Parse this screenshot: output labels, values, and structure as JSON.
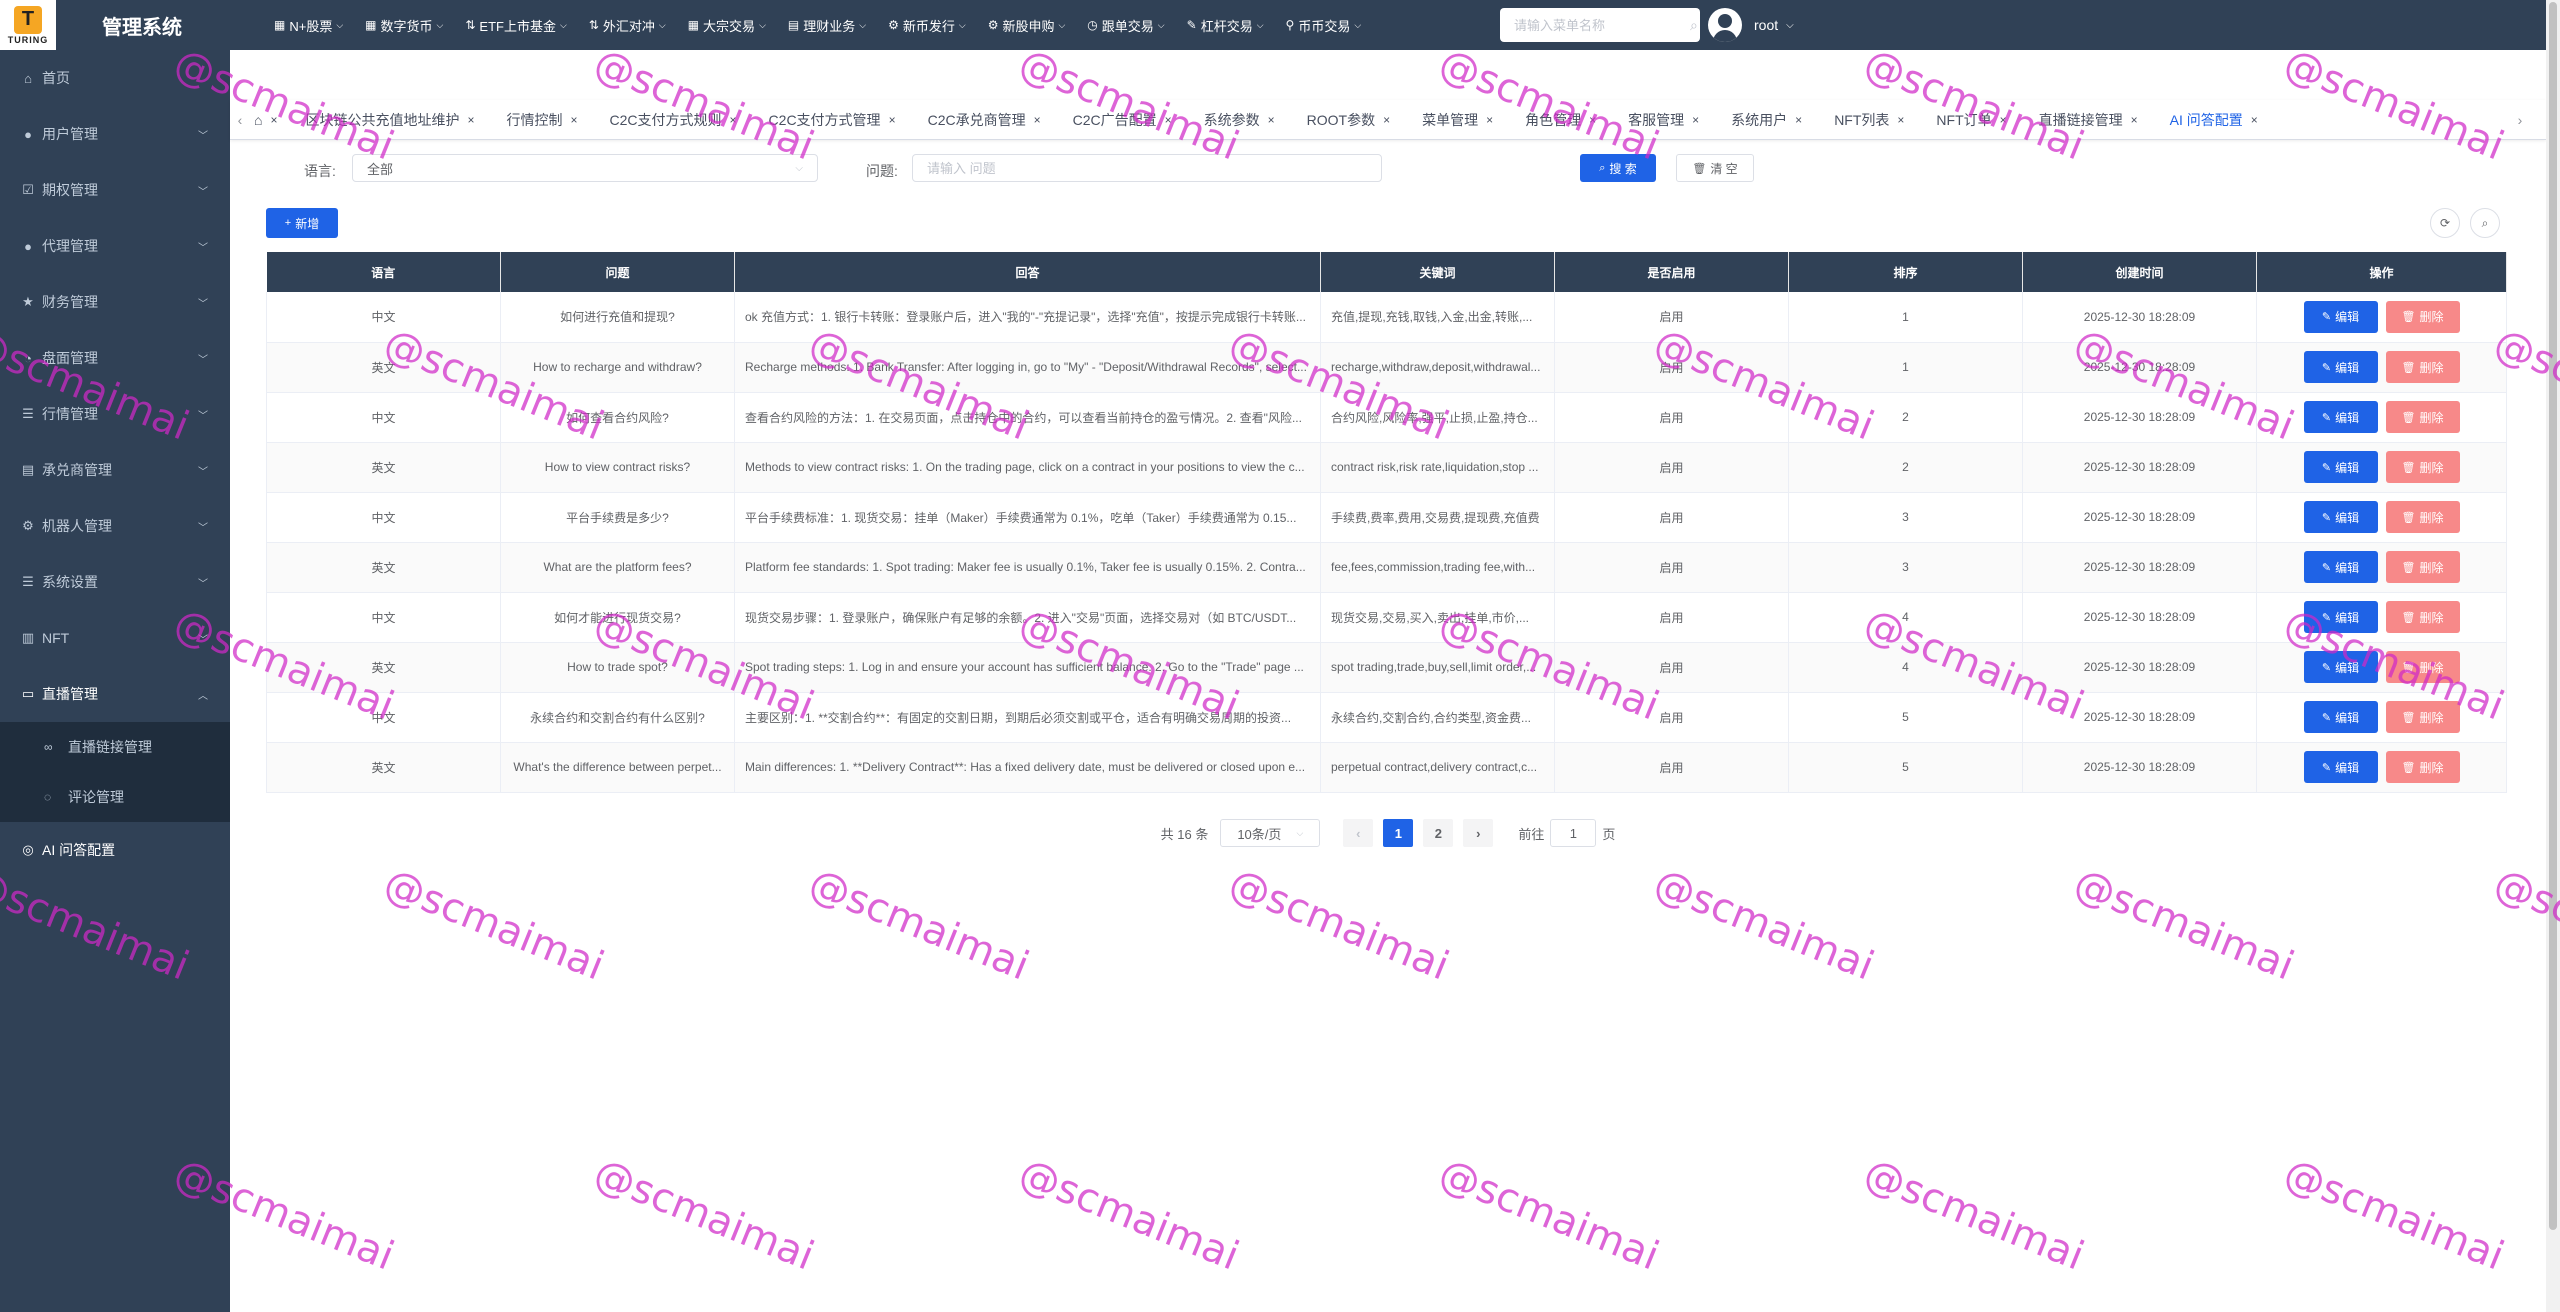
{
  "header": {
    "logo_text": "TURING",
    "title": "管理系统",
    "menus": [
      {
        "icon": "stock-icon",
        "glyph": "▦",
        "label": "N+股票"
      },
      {
        "icon": "chart-icon",
        "glyph": "▦",
        "label": "数字货币"
      },
      {
        "icon": "chart-icon",
        "glyph": "⇅",
        "label": "ETF上市基金"
      },
      {
        "icon": "chart-icon",
        "glyph": "⇅",
        "label": "外汇对冲"
      },
      {
        "icon": "chart-icon",
        "glyph": "▦",
        "label": "大宗交易"
      },
      {
        "icon": "chart-icon",
        "glyph": "▤",
        "label": "理财业务"
      },
      {
        "icon": "gear-icon",
        "glyph": "⚙",
        "label": "新币发行"
      },
      {
        "icon": "gear-icon",
        "glyph": "⚙",
        "label": "新股申购"
      },
      {
        "icon": "clock-icon",
        "glyph": "◷",
        "label": "跟单交易"
      },
      {
        "icon": "tool-icon",
        "glyph": "✎",
        "label": "杠杆交易"
      },
      {
        "icon": "pin-icon",
        "glyph": "⚲",
        "label": "币币交易"
      }
    ],
    "search_placeholder": "请输入菜单名称",
    "user_name": "root"
  },
  "sidebar": {
    "items": [
      {
        "icon": "home-icon",
        "glyph": "⌂",
        "label": "首页",
        "has_arrow": false
      },
      {
        "icon": "user-icon",
        "glyph": "●",
        "label": "用户管理",
        "has_arrow": true
      },
      {
        "icon": "check-icon",
        "glyph": "☑",
        "label": "期权管理",
        "has_arrow": true
      },
      {
        "icon": "user-icon",
        "glyph": "●",
        "label": "代理管理",
        "has_arrow": true
      },
      {
        "icon": "star-icon",
        "glyph": "★",
        "label": "财务管理",
        "has_arrow": true
      },
      {
        "icon": "pie-icon",
        "glyph": "◔",
        "label": "盘面管理",
        "has_arrow": true
      },
      {
        "icon": "list-icon",
        "glyph": "☰",
        "label": "行情管理",
        "has_arrow": true
      },
      {
        "icon": "form-icon",
        "glyph": "▤",
        "label": "承兑商管理",
        "has_arrow": true
      },
      {
        "icon": "robot-icon",
        "glyph": "⚙",
        "label": "机器人管理",
        "has_arrow": true
      },
      {
        "icon": "list-icon",
        "glyph": "☰",
        "label": "系统设置",
        "has_arrow": true
      },
      {
        "icon": "chart-icon",
        "glyph": "▥",
        "label": "NFT",
        "has_arrow": true
      },
      {
        "icon": "video-icon",
        "glyph": "▭",
        "label": "直播管理",
        "has_arrow": true
      }
    ],
    "sub_items": [
      {
        "icon": "link-icon",
        "glyph": "∞",
        "label": "直播链接管理"
      },
      {
        "icon": "comment-icon",
        "glyph": "◌",
        "label": "评论管理"
      }
    ],
    "last_item": {
      "icon": "circle-icon",
      "glyph": "◎",
      "label": "AI 问答配置"
    }
  },
  "tags": [
    {
      "label": "区块链公共充值地址维护"
    },
    {
      "label": "行情控制"
    },
    {
      "label": "C2C支付方式规则"
    },
    {
      "label": "C2C支付方式管理"
    },
    {
      "label": "C2C承兑商管理"
    },
    {
      "label": "C2C广告配置"
    },
    {
      "label": "系统参数"
    },
    {
      "label": "ROOT参数"
    },
    {
      "label": "菜单管理"
    },
    {
      "label": "角色管理"
    },
    {
      "label": "客服管理"
    },
    {
      "label": "系统用户"
    },
    {
      "label": "NFT列表"
    },
    {
      "label": "NFT订单"
    },
    {
      "label": "直播链接管理"
    },
    {
      "label": "AI 问答配置"
    }
  ],
  "filters": {
    "language_label": "语言:",
    "language_value": "全部",
    "question_label": "问题:",
    "question_placeholder": "请输入 问题",
    "search_label": "搜 索",
    "clear_label": "清 空"
  },
  "add_label": "新增",
  "table": {
    "headers": [
      "语言",
      "问题",
      "回答",
      "关键词",
      "是否启用",
      "排序",
      "创建时间",
      "操作"
    ],
    "edit_label": "编辑",
    "delete_label": "删除",
    "rows": [
      {
        "lang": "中文",
        "question": "如何进行充值和提现?",
        "answer": "ok 充值方式：1. 银行卡转账：登录账户后，进入\"我的\"-\"充提记录\"，选择\"充值\"，按提示完成银行卡转账...",
        "keywords": "充值,提现,充钱,取钱,入金,出金,转账,...",
        "enabled": "启用",
        "sort": "1",
        "created": "2025-12-30 18:28:09"
      },
      {
        "lang": "英文",
        "question": "How to recharge and withdraw?",
        "answer": "Recharge methods: 1. Bank Transfer: After logging in, go to \"My\" - \"Deposit/Withdrawal Records\", select...",
        "keywords": "recharge,withdraw,deposit,withdrawal...",
        "enabled": "启用",
        "sort": "1",
        "created": "2025-12-30 18:28:09"
      },
      {
        "lang": "中文",
        "question": "如何查看合约风险?",
        "answer": "查看合约风险的方法：1. 在交易页面，点击持仓中的合约，可以查看当前持仓的盈亏情况。2. 查看\"风险...",
        "keywords": "合约风险,风险率,强平,止损,止盈,持仓...",
        "enabled": "启用",
        "sort": "2",
        "created": "2025-12-30 18:28:09"
      },
      {
        "lang": "英文",
        "question": "How to view contract risks?",
        "answer": "Methods to view contract risks: 1. On the trading page, click on a contract in your positions to view the c...",
        "keywords": "contract risk,risk rate,liquidation,stop ...",
        "enabled": "启用",
        "sort": "2",
        "created": "2025-12-30 18:28:09"
      },
      {
        "lang": "中文",
        "question": "平台手续费是多少?",
        "answer": "平台手续费标准：1. 现货交易：挂单（Maker）手续费通常为 0.1%，吃单（Taker）手续费通常为 0.15...",
        "keywords": "手续费,费率,费用,交易费,提现费,充值费",
        "enabled": "启用",
        "sort": "3",
        "created": "2025-12-30 18:28:09"
      },
      {
        "lang": "英文",
        "question": "What are the platform fees?",
        "answer": "Platform fee standards: 1. Spot trading: Maker fee is usually 0.1%, Taker fee is usually 0.15%. 2. Contra...",
        "keywords": "fee,fees,commission,trading fee,with...",
        "enabled": "启用",
        "sort": "3",
        "created": "2025-12-30 18:28:09"
      },
      {
        "lang": "中文",
        "question": "如何才能进行现货交易?",
        "answer": "现货交易步骤：1. 登录账户，确保账户有足够的余额。2. 进入\"交易\"页面，选择交易对（如 BTC/USDT...",
        "keywords": "现货交易,交易,买入,卖出,挂单,市价,...",
        "enabled": "启用",
        "sort": "4",
        "created": "2025-12-30 18:28:09"
      },
      {
        "lang": "英文",
        "question": "How to trade spot?",
        "answer": "Spot trading steps: 1. Log in and ensure your account has sufficient balance. 2. Go to the \"Trade\" page ...",
        "keywords": "spot trading,trade,buy,sell,limit order,...",
        "enabled": "启用",
        "sort": "4",
        "created": "2025-12-30 18:28:09"
      },
      {
        "lang": "中文",
        "question": "永续合约和交割合约有什么区别?",
        "answer": "主要区别：1. **交割合约**：有固定的交割日期，到期后必须交割或平仓，适合有明确交易周期的投资...",
        "keywords": "永续合约,交割合约,合约类型,资金费...",
        "enabled": "启用",
        "sort": "5",
        "created": "2025-12-30 18:28:09"
      },
      {
        "lang": "英文",
        "question": "What's the difference between perpet...",
        "answer": "Main differences: 1. **Delivery Contract**: Has a fixed delivery date, must be delivered or closed upon e...",
        "keywords": "perpetual contract,delivery contract,c...",
        "enabled": "启用",
        "sort": "5",
        "created": "2025-12-30 18:28:09"
      }
    ]
  },
  "pagination": {
    "total": "共 16 条",
    "page_size": "10条/页",
    "pages": [
      "1",
      "2"
    ],
    "current": "1",
    "goto_prefix": "前往",
    "goto_value": "1",
    "goto_suffix": "页"
  },
  "watermark": "@scmaimai",
  "colors": {
    "primary": "#1f63e6",
    "danger": "#f78989",
    "sidebar_bg": "#304156",
    "watermark": "#d028c8"
  }
}
